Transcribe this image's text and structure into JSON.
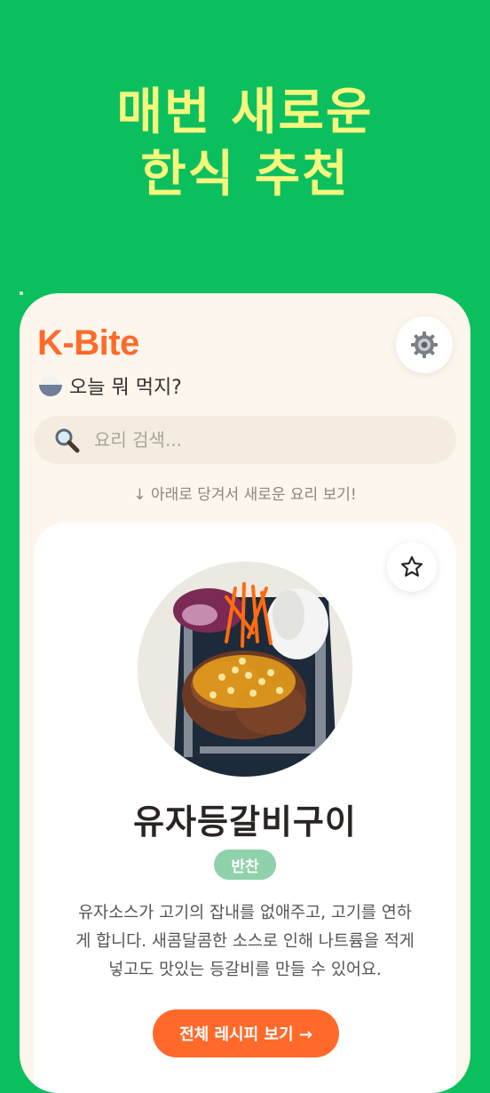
{
  "hero": {
    "line1": "매번 새로운",
    "line2": "한식 추천"
  },
  "app": {
    "brand": "K-Bite",
    "subtitle": "오늘 뭐 먹지?",
    "subtitle_icon": "rice-bowl-icon",
    "settings_icon": "gear-icon"
  },
  "search": {
    "placeholder": "요리 검색...",
    "value": "",
    "icon": "magnifier-icon"
  },
  "pull_hint": "↓ 아래로 당겨서 새로운 요리 보기!",
  "recipe": {
    "title": "유자등갈비구이",
    "category": "반찬",
    "description": "유자소스가 고기의 잡내를 없애주고, 고기를 연하게 합니다. 새콤달콤한 소스로 인해 나트륨을 적게 넣고도 맛있는 등갈비를 만들 수 있어요.",
    "favorite_icon": "star-outline-icon",
    "cta_label": "전체 레시피 보기 →"
  },
  "colors": {
    "background": "#0bbf5f",
    "hero_text": "#f6f77d",
    "brand": "#ff6a2b",
    "category_badge": "#8fd1aa",
    "cta": "#ff6a2b",
    "panel": "#fdf6ec"
  }
}
